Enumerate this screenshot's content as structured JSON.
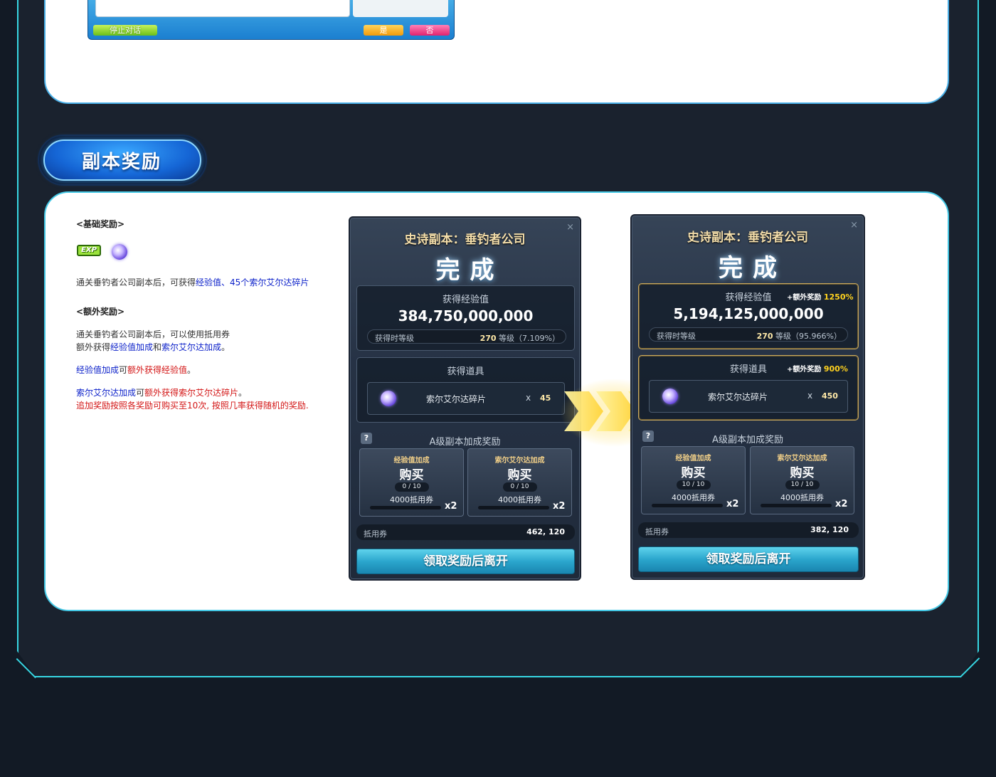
{
  "top_dialog": {
    "stop_label": "停止对话",
    "yes_label": "是",
    "no_label": "否"
  },
  "section": {
    "title": "副本奖励"
  },
  "description": {
    "basic_heading": "<基础奖励>",
    "exp_badge": "EXP",
    "basic_text_prefix": "通关垂钓者公司副本后，可获得",
    "basic_text_exp": "经验值",
    "basic_text_mid": "、45个",
    "basic_text_shard": "索尔艾尔达碎片",
    "extra_heading": "<额外奖励>",
    "extra_line1": "通关垂钓者公司副本后，可以使用抵用券",
    "extra_line2_prefix": "额外获得",
    "extra_line2_exp": "经验值加成",
    "extra_line2_and": "和",
    "extra_line2_shard": "索尔艾尔达加成",
    "extra_line2_end": "。",
    "exp_bonus_a": "经验值加成",
    "exp_bonus_b": "可",
    "exp_bonus_c": "额外获得经验值",
    "exp_bonus_d": "。",
    "shard_bonus_a": "索尔艾尔达加成",
    "shard_bonus_b": "可",
    "shard_bonus_c": "额外获得索尔艾尔达碎片",
    "shard_bonus_d": "。",
    "note": "追加奖励按照各奖励可购买至10次, 按照几率获得随机的奖励."
  },
  "windows": [
    {
      "title": "史诗副本：垂钓者公司",
      "complete": "完成",
      "close": "×",
      "exp_label": "获得经验值",
      "exp_value": "384,750,000,000",
      "level_label": "获得时等级",
      "level_value": "270",
      "level_unit": "等级（7.109%）",
      "exp_bonus_label": "",
      "exp_bonus_pct": "",
      "items_label": "获得道具",
      "item_bonus_label": "",
      "item_bonus_pct": "",
      "item_name": "索尔艾尔达碎片",
      "item_x": "x",
      "item_qty": "45",
      "help": "?",
      "bonus_title": "A级副本加成奖励",
      "card1_title": "经验值加成",
      "card1_buy": "购买",
      "card1_count": "0 / 10",
      "card1_cost": "4000抵用券",
      "card1_mult": "x2",
      "card2_title": "索尔艾尔达加成",
      "card2_buy": "购买",
      "card2_count": "0 / 10",
      "card2_cost": "4000抵用券",
      "card2_mult": "x2",
      "coupon_label": "抵用券",
      "coupon_value": "462, 120",
      "exit": "领取奖励后离开"
    },
    {
      "title": "史诗副本：垂钓者公司",
      "complete": "完成",
      "close": "×",
      "exp_label": "获得经验值",
      "exp_value": "5,194,125,000,000",
      "level_label": "获得时等级",
      "level_value": "270",
      "level_unit": "等级（95.966%）",
      "exp_bonus_label": "+额外奖励",
      "exp_bonus_pct": "1250%",
      "items_label": "获得道具",
      "item_bonus_label": "+额外奖励",
      "item_bonus_pct": "900%",
      "item_name": "索尔艾尔达碎片",
      "item_x": "x",
      "item_qty": "450",
      "help": "?",
      "bonus_title": "A级副本加成奖励",
      "card1_title": "经验值加成",
      "card1_buy": "购买",
      "card1_count": "10 / 10",
      "card1_cost": "4000抵用券",
      "card1_mult": "x2",
      "card2_title": "索尔艾尔达加成",
      "card2_buy": "购买",
      "card2_count": "10 / 10",
      "card2_cost": "4000抵用券",
      "card2_mult": "x2",
      "coupon_label": "抵用券",
      "coupon_value": "382, 120",
      "exit": "领取奖励后离开"
    }
  ],
  "colors": {
    "frame": "#37d7e3",
    "background": "#121a25",
    "exit_button": "#2ba6cd",
    "blue_text": "#0a1fc9",
    "red_text": "#d31616",
    "bonus_pct": "#ffd21e"
  }
}
